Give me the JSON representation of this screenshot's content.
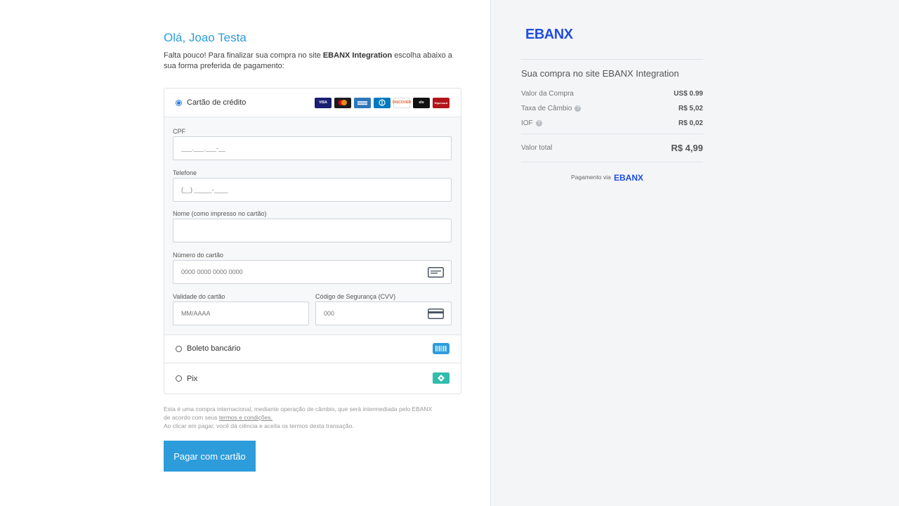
{
  "greeting": "Olá, Joao Testa",
  "intro": {
    "before": "Falta pouco! Para finalizar sua compra no site ",
    "merchant": "EBANX Integration",
    "after": " escolha abaixo a sua forma preferida de pagamento:"
  },
  "payment_methods": {
    "credit_card": {
      "label": "Cartão de crédito",
      "selected": true,
      "brands": [
        "VISA",
        "Mastercard",
        "Amex",
        "Diners",
        "DISCOVER",
        "elo",
        "Hipercard"
      ]
    },
    "boleto": {
      "label": "Boleto bancário",
      "selected": false
    },
    "pix": {
      "label": "Pix",
      "selected": false
    }
  },
  "form": {
    "cpf": {
      "label": "CPF",
      "placeholder": "___.___.___-__"
    },
    "phone": {
      "label": "Telefone",
      "placeholder": "(__) _____-____"
    },
    "name": {
      "label": "Nome (como impresso no cartão)",
      "placeholder": ""
    },
    "card_number": {
      "label": "Número do cartão",
      "placeholder": "0000 0000 0000 0000"
    },
    "expiry": {
      "label": "Validade do cartão",
      "placeholder": "MM/AAAA"
    },
    "cvv": {
      "label": "Código de Segurança (CVV)",
      "placeholder": "000"
    }
  },
  "legal": {
    "line1": "Esta é uma compra internacional, mediante operação de câmbio, que será intermediada pelo EBANX",
    "line2_prefix": "de acordo com seus ",
    "terms_link": "termos e condições.",
    "line3": "Ao clicar em pagar, você dá ciência e aceita os termos desta transação."
  },
  "pay_button": "Pagar com cartão",
  "summary": {
    "logo_text": "EBANX",
    "title": "Sua compra no site EBANX Integration",
    "rows": [
      {
        "label": "Valor da Compra",
        "value": "US$ 0.99"
      },
      {
        "label": "Taxa de Câmbio",
        "value": "R$ 5,02"
      },
      {
        "label": "IOF",
        "value": "R$ 0,02"
      }
    ],
    "total_label": "Valor total",
    "total_value": "R$ 4,99",
    "via_label": "Pagamento via",
    "via_logo": "EBANX"
  },
  "colors": {
    "accent": "#2d9cdb",
    "logo_blue": "#1f4de0",
    "boleto_icon": "#2d9cdb",
    "pix_icon": "#32bcad"
  }
}
